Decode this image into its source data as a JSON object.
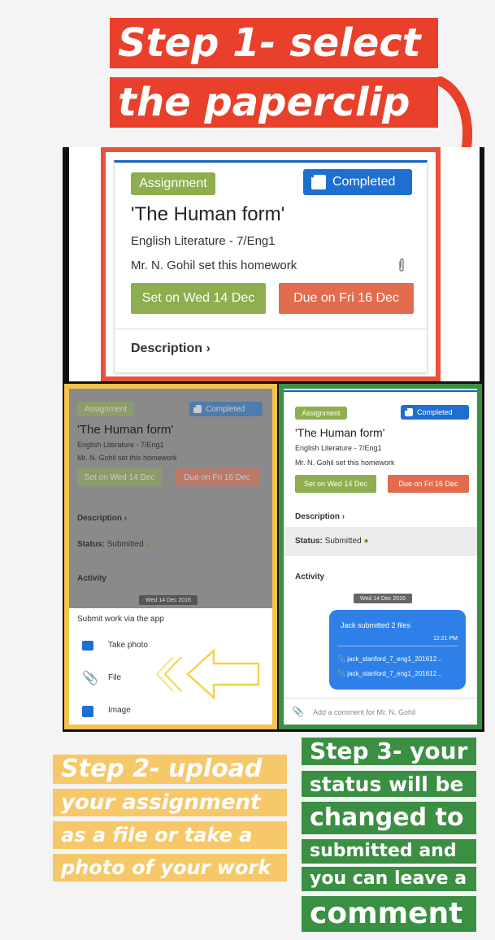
{
  "steps": {
    "step1_line1": "Step 1- select",
    "step1_line2": "the paperclip",
    "step2_lines": [
      "Step 2- upload",
      "your assignment",
      "as a file or take a",
      "photo of your work"
    ],
    "step3_lines": [
      "Step 3- your",
      "status will be",
      "changed to",
      "submitted and",
      "you can leave a",
      "comment"
    ]
  },
  "card": {
    "tag_label": "Assignment",
    "completed_label": "Completed",
    "title": "'The Human form'",
    "subject": "English Literature - 7/Eng1",
    "teacher_line": "Mr. N. Gohil set this homework",
    "set_label": "Set on Wed 14 Dec",
    "due_label": "Due on Fri 16 Dec",
    "description_label": "Description",
    "status_label": "Status:",
    "status_value": "Submitted",
    "activity_label": "Activity",
    "date_chip": "Wed 14 Dec 2016"
  },
  "upload_sheet": {
    "heading": "Submit work via the app",
    "options": [
      "Take photo",
      "File",
      "Image"
    ]
  },
  "activity": {
    "message": "Jack submitted 2 files",
    "time": "12:21 PM",
    "files": [
      "jack_stanford_7_eng1_201612...",
      "jack_stanford_7_eng1_201612..."
    ],
    "comment_placeholder": "Add a comment for Mr. N. Gohil"
  },
  "colors": {
    "red": "#e8402b",
    "yellow": "#f6c86a",
    "green": "#3a8f43",
    "blue": "#1e6fd0",
    "assignment_green": "#8fae4f",
    "due_orange": "#e36c4f"
  }
}
